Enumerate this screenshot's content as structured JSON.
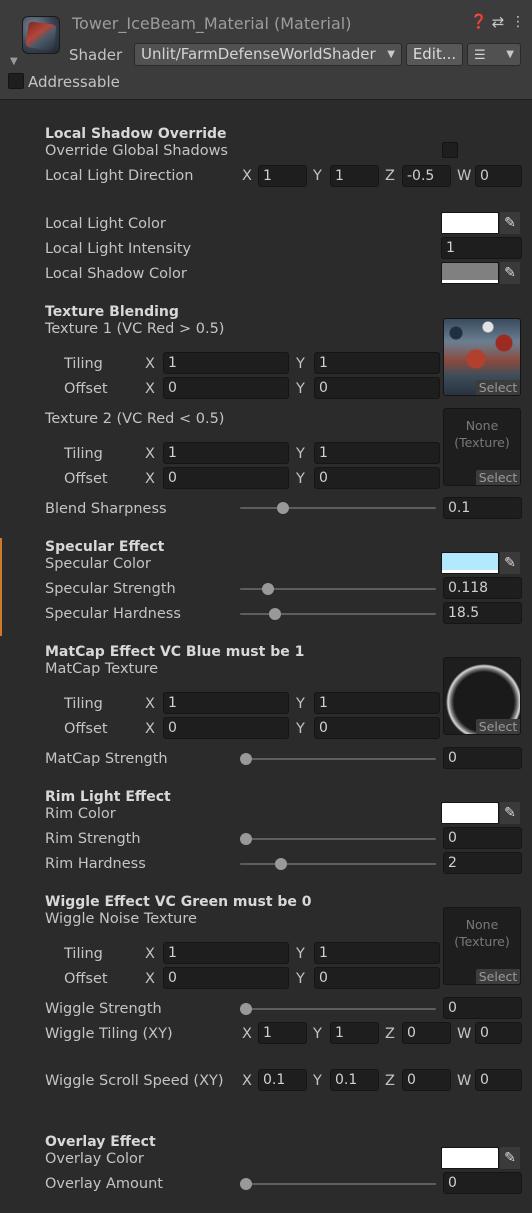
{
  "header": {
    "title": "Tower_IceBeam_Material (Material)",
    "shader_label": "Shader",
    "shader_value": "Unlit/FarmDefenseWorldShader",
    "edit_label": "Edit...",
    "addressable_label": "Addressable",
    "addressable_checked": false
  },
  "local_shadow": {
    "title": "Local Shadow Override",
    "override_label": "Override Global Shadows",
    "override_checked": false,
    "direction_label": "Local Light Direction",
    "direction": {
      "x": "1",
      "y": "1",
      "z": "-0.5",
      "w": "0"
    },
    "light_color_label": "Local Light Color",
    "light_color": "#ffffff",
    "intensity_label": "Local Light Intensity",
    "intensity": "1",
    "shadow_color_label": "Local Shadow Color",
    "shadow_color": "#808080"
  },
  "texture_blending": {
    "title": "Texture Blending",
    "tex1_label": "Texture 1 (VC Red > 0.5)",
    "tex2_label": "Texture 2 (VC Red < 0.5)",
    "tiling_label": "Tiling",
    "offset_label": "Offset",
    "tex1": {
      "tiling_x": "1",
      "tiling_y": "1",
      "offset_x": "0",
      "offset_y": "0"
    },
    "tex2": {
      "tiling_x": "1",
      "tiling_y": "1",
      "offset_x": "0",
      "offset_y": "0"
    },
    "sharpness_label": "Blend Sharpness",
    "sharpness": "0.1",
    "sharpness_fraction": 0.2
  },
  "specular": {
    "title": "Specular Effect",
    "color_label": "Specular Color",
    "color": "#b3e9ff",
    "strength_label": "Specular Strength",
    "strength": "0.118",
    "strength_fraction": 0.118,
    "hardness_label": "Specular Hardness",
    "hardness": "18.5",
    "hardness_fraction": 0.16
  },
  "matcap": {
    "title": "MatCap Effect VC Blue must be 1",
    "texture_label": "MatCap Texture",
    "tiling_x": "1",
    "tiling_y": "1",
    "offset_x": "0",
    "offset_y": "0",
    "strength_label": "MatCap Strength",
    "strength": "0",
    "strength_fraction": 0
  },
  "rim": {
    "title": "Rim Light Effect",
    "color_label": "Rim Color",
    "color": "#ffffff",
    "strength_label": "Rim Strength",
    "strength": "0",
    "strength_fraction": 0,
    "hardness_label": "Rim Hardness",
    "hardness": "2",
    "hardness_fraction": 0.19
  },
  "wiggle": {
    "title": "Wiggle Effect VC Green must be 0",
    "texture_label": "Wiggle Noise Texture",
    "tiling_x": "1",
    "tiling_y": "1",
    "offset_x": "0",
    "offset_y": "0",
    "strength_label": "Wiggle Strength",
    "strength": "0",
    "strength_fraction": 0,
    "tiling_label": "Wiggle Tiling (XY)",
    "tiling_vec": {
      "x": "1",
      "y": "1",
      "z": "0",
      "w": "0"
    },
    "scroll_label": "Wiggle Scroll Speed (XY)",
    "scroll_vec": {
      "x": "0.1",
      "y": "0.1",
      "z": "0",
      "w": "0"
    }
  },
  "overlay": {
    "title": "Overlay Effect",
    "color_label": "Overlay Color",
    "color": "#ffffff",
    "amount_label": "Overlay Amount",
    "amount": "0",
    "amount_fraction": 0
  },
  "common": {
    "select_label": "Select",
    "none_texture_label": "None\n(Texture)",
    "axis_x": "X",
    "axis_y": "Y",
    "axis_z": "Z",
    "axis_w": "W",
    "accent_bar_color": "#cd7b29",
    "eyedropper_icon": "eyedropper-icon"
  }
}
